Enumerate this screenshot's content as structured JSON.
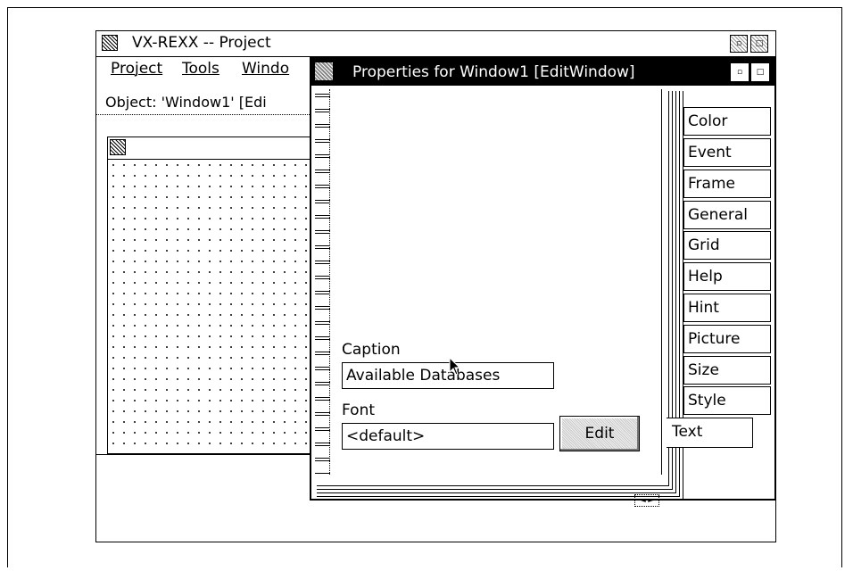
{
  "project_window": {
    "title": "VX-REXX -- Project",
    "menu": [
      "Project",
      "Tools",
      "Windo"
    ],
    "object_line": "Object: 'Window1' [Edi"
  },
  "properties_window": {
    "title": "Properties for Window1 [EditWindow]",
    "caption_label": "Caption",
    "caption_value": "Available Databases",
    "font_label": "Font",
    "font_value": "<default>",
    "edit_button": "Edit",
    "tabs": [
      "Color",
      "Event",
      "Frame",
      "General",
      "Grid",
      "Help",
      "Hint",
      "Picture",
      "Size",
      "Style"
    ],
    "selected_tab": "Text"
  }
}
